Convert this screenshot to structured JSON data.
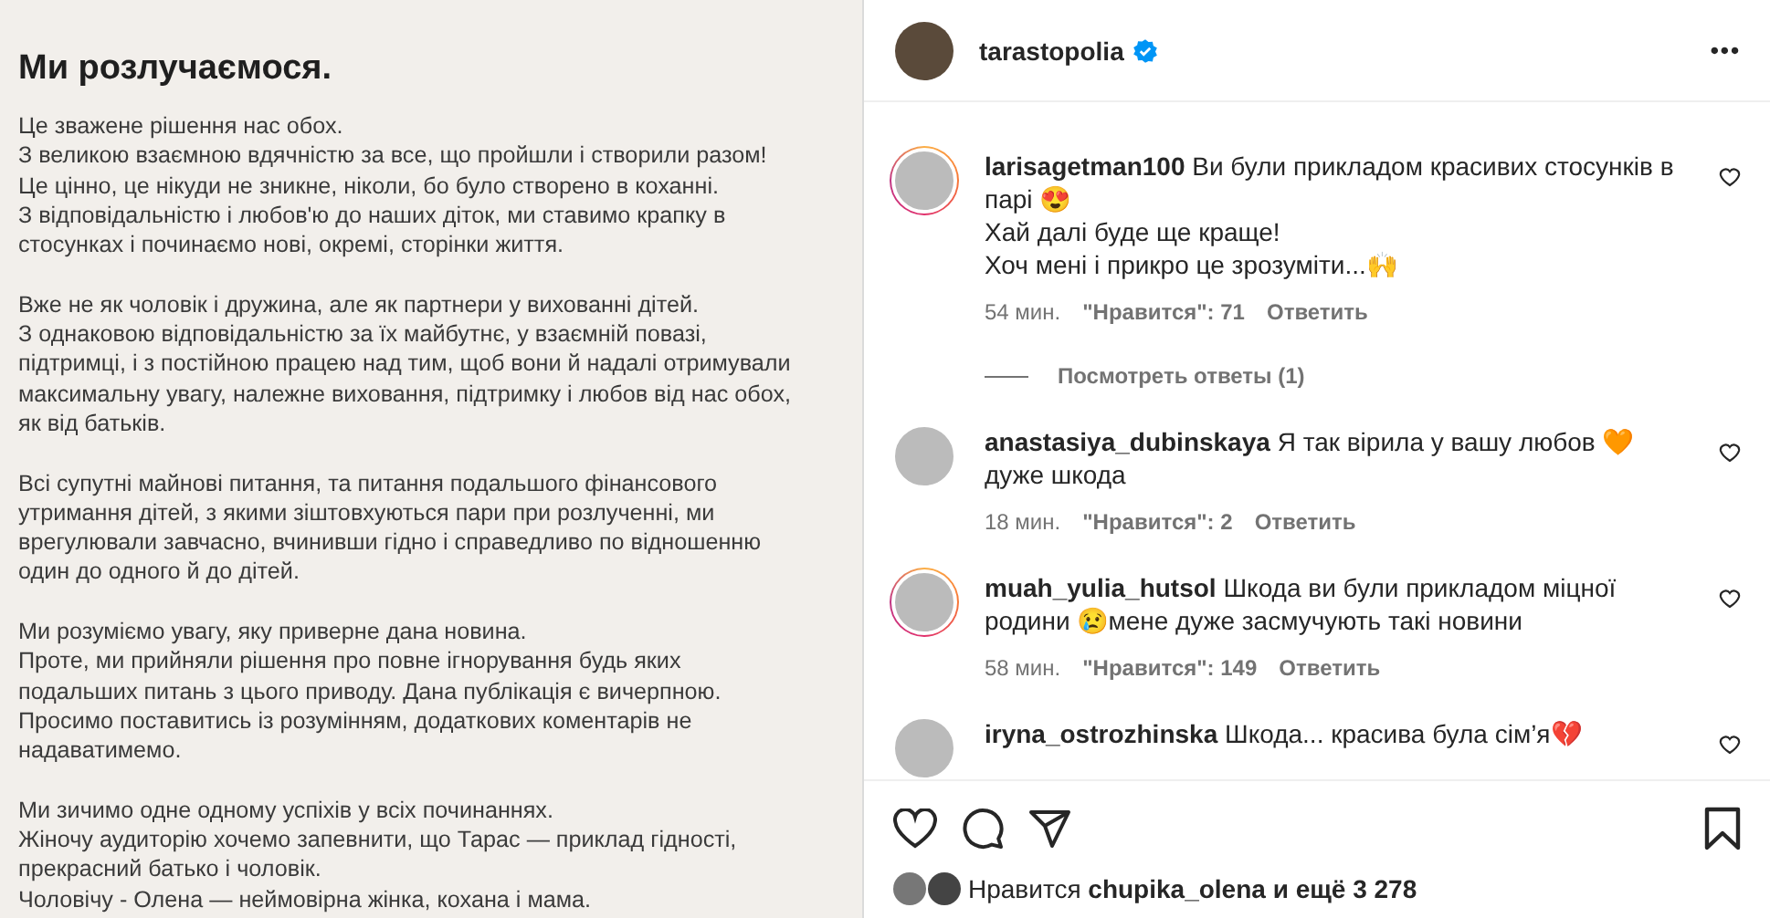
{
  "post_image": {
    "title": "Ми розлучаємося.",
    "paragraphs": [
      "Це зважене рішення нас обох.\nЗ великою взаємною вдячністю за все, що пройшли і створили разом!\nЦе цінно, це нікуди не зникне, ніколи, бо було створено в коханні.\nЗ відповідальністю і любов'ю до наших діток, ми ставимо крапку в\nстосунках і починаємо нові, окремі, сторінки життя.",
      "Вже не як чоловік і дружина, але як партнери у вихованні дітей.\nЗ однаковою відповідальністю за їх майбутнє, у взаємній повазі,\nпідтримці, і з постійною працею над тим, щоб вони й надалі отримували\nмаксимальну увагу, належне виховання, підтримку і любов від нас обох,\nяк від батьків.",
      "Всі супутні майнові питання, та питання подальшого фінансового\nутримання дітей, з якими зіштовхуються пари при розлученні, ми\nврегулювали завчасно, вчинивши гідно і справедливо по відношенню\nодин до одного й до дітей.",
      "Ми розуміємо увагу, яку приверне дана новина.\nПроте, ми прийняли рішення про повне ігнорування будь яких\nподальших питань з цього приводу. Дана публікація є вичерпною.\nПросимо поставитись із розумінням, додаткових коментарів не\nнадаватимемо.",
      "Ми зичимо одне одному успіхів у всіх починаннях.\nЖіночу аудиторію хочемо запевнити, що Тарас — приклад гідності,\nпрекрасний батько і чоловік.\nЧоловічу - Олена — неймовірна жінка, кохана і мама."
    ]
  },
  "header": {
    "username": "tarastopolia",
    "verified": true,
    "more": "•••"
  },
  "comments": [
    {
      "username": "larisagetman100",
      "text": "Ви були прикладом красивих стосунків в парі 😍\nХай далі буде ще краще!\nХоч мені і прикро це зрозуміти...🙌",
      "time": "54 мин.",
      "likes": "\"Нравится\": 71",
      "reply": "Ответить",
      "story_ring": true,
      "view_replies": "Посмотреть ответы (1)"
    },
    {
      "username": "anastasiya_dubinskaya",
      "text": "Я так вірила у вашу любов 🧡 дуже шкода",
      "time": "18 мин.",
      "likes": "\"Нравится\": 2",
      "reply": "Ответить",
      "story_ring": false
    },
    {
      "username": "muah_yulia_hutsol",
      "text": "Шкода ви були прикладом міцної родини 😢мене дуже засмучують такі новини",
      "time": "58 мин.",
      "likes": "\"Нравится\": 149",
      "reply": "Ответить",
      "story_ring": true
    },
    {
      "username": "iryna_ostrozhinska",
      "text": "Шкода... красива була сім’я💔",
      "story_ring": false
    }
  ],
  "likes_line": "Нравится **chupika_olena и ещё 3 278**"
}
